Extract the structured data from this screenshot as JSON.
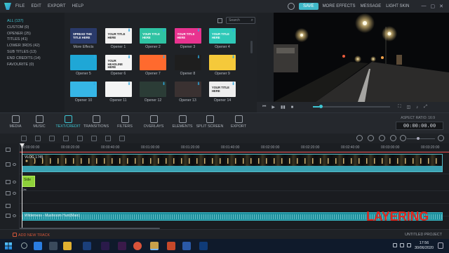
{
  "menu": {
    "items": [
      "FILE",
      "EDIT",
      "EXPORT",
      "HELP"
    ]
  },
  "topright": {
    "save": "SAVE",
    "more_effects": "MORE EFFECTS",
    "message": "MESSAGE",
    "light_skin": "LIGHT SKIN"
  },
  "categories": [
    "ALL (137)",
    "CUSTOM (0)",
    "OPENER (25)",
    "TITLES (41)",
    "LOWER 3RDS (42)",
    "SUB TITLES (13)",
    "END CREDITS (14)",
    "FAVOURITE (0)"
  ],
  "search": {
    "placeholder": "Search"
  },
  "tiles": [
    {
      "label": "More Effects",
      "color": "#2a3a6a",
      "text": "SPREAD THE TITLE HERE"
    },
    {
      "label": "Opener 1",
      "color": "#f2f2f2",
      "text": "YOUR TITLE HERE"
    },
    {
      "label": "Opener 2",
      "color": "#2fc3a3",
      "text": "YOUR TITLE HERE"
    },
    {
      "label": "Opener 3",
      "color": "#e8338f",
      "text": "YOUR TITLE HERE"
    },
    {
      "label": "Opener 4",
      "color": "#2fc9b8",
      "text": "YOUR TITLE HERE"
    },
    {
      "label": "Opener 5",
      "color": "#1fa7d6",
      "text": ""
    },
    {
      "label": "Opener 6",
      "color": "#f4f4f4",
      "text": "YOUR HEADLINE HERE"
    },
    {
      "label": "Opener 7",
      "color": "#ff6a2e",
      "text": ""
    },
    {
      "label": "Opener 8",
      "color": "#1e1e1e",
      "text": ""
    },
    {
      "label": "Opener 9",
      "color": "#f5c93a",
      "text": ""
    },
    {
      "label": "Opener 10",
      "color": "#36b6e6",
      "text": ""
    },
    {
      "label": "Opener 11",
      "color": "#f4f4f4",
      "text": ""
    },
    {
      "label": "Opener 12",
      "color": "#2b3c36",
      "text": ""
    },
    {
      "label": "Opener 13",
      "color": "#3a3131",
      "text": ""
    },
    {
      "label": "Opener 14",
      "color": "#eeeeee",
      "text": "YOUR TITLE HERE"
    }
  ],
  "toolbar": {
    "items": [
      "MEDIA",
      "MUSIC",
      "TEXT/CREDIT",
      "TRANSITIONS",
      "FILTERS",
      "OVERLAYS",
      "ELEMENTS",
      "SPLIT SCREEN",
      "EXPORT"
    ],
    "aspect": "ASPECT RATIO: 16:9",
    "timecode": "00:00:00.00"
  },
  "ruler": [
    "00:00:00:00",
    "00:00:20:00",
    "00:00:40:00",
    "00:01:00:00",
    "00:01:20:00",
    "00:01:40:00",
    "00:02:00:00",
    "00:02:20:00",
    "00:02:40:00",
    "00:03:00:00",
    "00:03:20:00"
  ],
  "clips": {
    "video": "VLOG 1745",
    "title": "Side",
    "audio": "Wilderness - Mushroom Hunt(Main)"
  },
  "overlay": "LAYERING",
  "status": {
    "add_track": "ADD NEW TRACK",
    "project": "UNTITLED PROJECT"
  },
  "taskbar": {
    "time": "17:56",
    "date": "30/06/2020"
  }
}
